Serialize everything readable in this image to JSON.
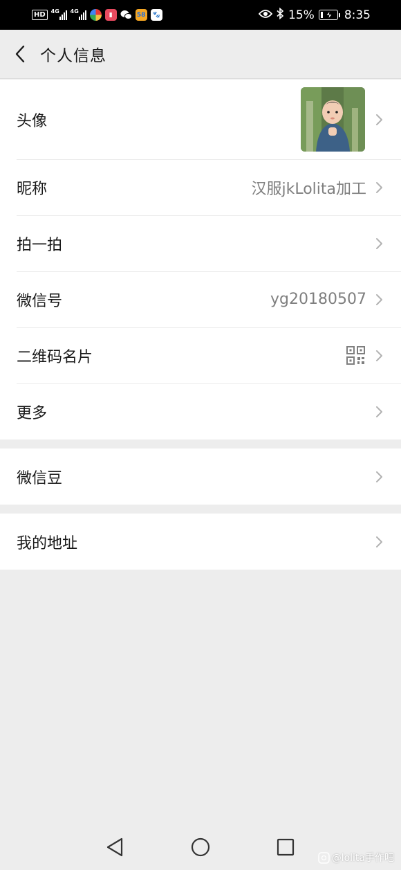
{
  "status_bar": {
    "hd_label": "HD",
    "net_1": "4G",
    "net_2": "4G",
    "app_icon_58": "58",
    "battery_percent": "15%",
    "battery_level": 0.15,
    "time": "8:35"
  },
  "header": {
    "title": "个人信息"
  },
  "profile_group": {
    "avatar_label": "头像",
    "nickname_label": "昵称",
    "nickname_value": "汉服jkLolita加工",
    "pat_label": "拍一拍",
    "wechat_id_label": "微信号",
    "wechat_id_value": "yg20180507",
    "qrcode_label": "二维码名片",
    "more_label": "更多"
  },
  "beans_group": {
    "beans_label": "微信豆"
  },
  "address_group": {
    "address_label": "我的地址"
  },
  "watermark": {
    "text": "@lolita手作吧"
  },
  "colors": {
    "background": "#ededed",
    "card": "#ffffff",
    "text_primary": "#191919",
    "text_secondary": "#7f7f7f",
    "chevron": "#b2b2b2"
  }
}
